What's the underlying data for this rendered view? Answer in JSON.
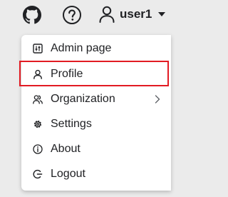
{
  "header": {
    "username": "user1",
    "github_icon": "github-icon",
    "help_icon": "help-circle-icon",
    "user_icon": "user-icon",
    "caret_icon": "caret-down-icon"
  },
  "menu": {
    "items": [
      {
        "label": "Admin page",
        "icon": "admin-panel-icon"
      },
      {
        "label": "Profile",
        "icon": "user-icon"
      },
      {
        "label": "Organization",
        "icon": "users-icon"
      },
      {
        "label": "Settings",
        "icon": "gear-icon"
      },
      {
        "label": "About",
        "icon": "info-icon"
      },
      {
        "label": "Logout",
        "icon": "logout-icon"
      }
    ],
    "highlighted_item": "Profile"
  },
  "colors": {
    "page_background": "#ebebeb",
    "menu_background": "#ffffff",
    "text": "#202124",
    "highlight_border": "#e21b23"
  }
}
